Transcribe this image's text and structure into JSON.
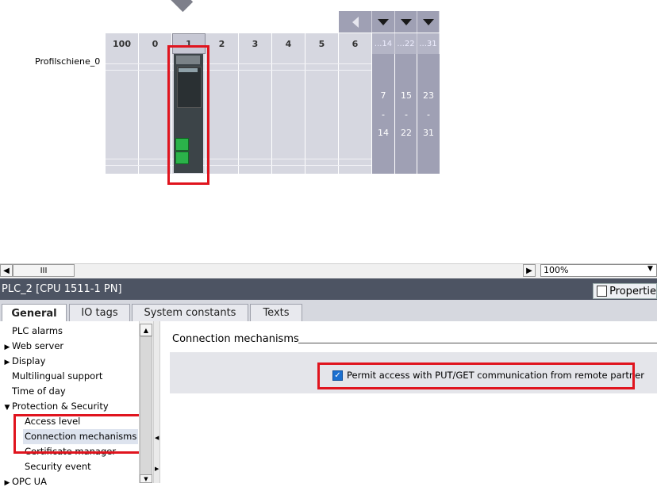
{
  "device_view": {
    "rack_name": "Profilschiene_0",
    "slots": [
      "100",
      "0",
      "1",
      "2",
      "3",
      "4",
      "5",
      "6"
    ],
    "selected_slot": "1",
    "expansion_headers": [
      "...14",
      "...22",
      "...31"
    ],
    "expansion_ranges": [
      {
        "start": "7",
        "sep": "-",
        "end": "14"
      },
      {
        "start": "15",
        "sep": "-",
        "end": "22"
      },
      {
        "start": "23",
        "sep": "-",
        "end": "31"
      }
    ]
  },
  "view_toolbar": {
    "scroll_thumb_glyph": "III",
    "zoom_value": "100%"
  },
  "inspector": {
    "title": "PLC_2 [CPU 1511-1 PN]",
    "properties_label": "Propertie",
    "tabs": [
      "General",
      "IO tags",
      "System constants",
      "Texts"
    ],
    "active_tab": "General",
    "tree": [
      {
        "label": "PLC alarms",
        "indent": 0,
        "expander": ""
      },
      {
        "label": "Web server",
        "indent": 0,
        "expander": "collapsed"
      },
      {
        "label": "Display",
        "indent": 0,
        "expander": "collapsed"
      },
      {
        "label": "Multilingual support",
        "indent": 0,
        "expander": ""
      },
      {
        "label": "Time of day",
        "indent": 0,
        "expander": ""
      },
      {
        "label": "Protection & Security",
        "indent": 0,
        "expander": "expanded"
      },
      {
        "label": "Access level",
        "indent": 1,
        "expander": ""
      },
      {
        "label": "Connection mechanisms",
        "indent": 1,
        "expander": "",
        "selected": true
      },
      {
        "label": "Certificate manager",
        "indent": 1,
        "expander": ""
      },
      {
        "label": "Security event",
        "indent": 1,
        "expander": ""
      },
      {
        "label": "OPC UA",
        "indent": 0,
        "expander": "collapsed"
      }
    ],
    "section_title": "Connection mechanisms",
    "permit_put_get": {
      "checked": true,
      "label": "Permit access with PUT/GET communication from remote partner"
    }
  },
  "colors": {
    "highlight_red": "#e0141e",
    "title_bar": "#4d5463",
    "port_green": "#2bb34a"
  }
}
